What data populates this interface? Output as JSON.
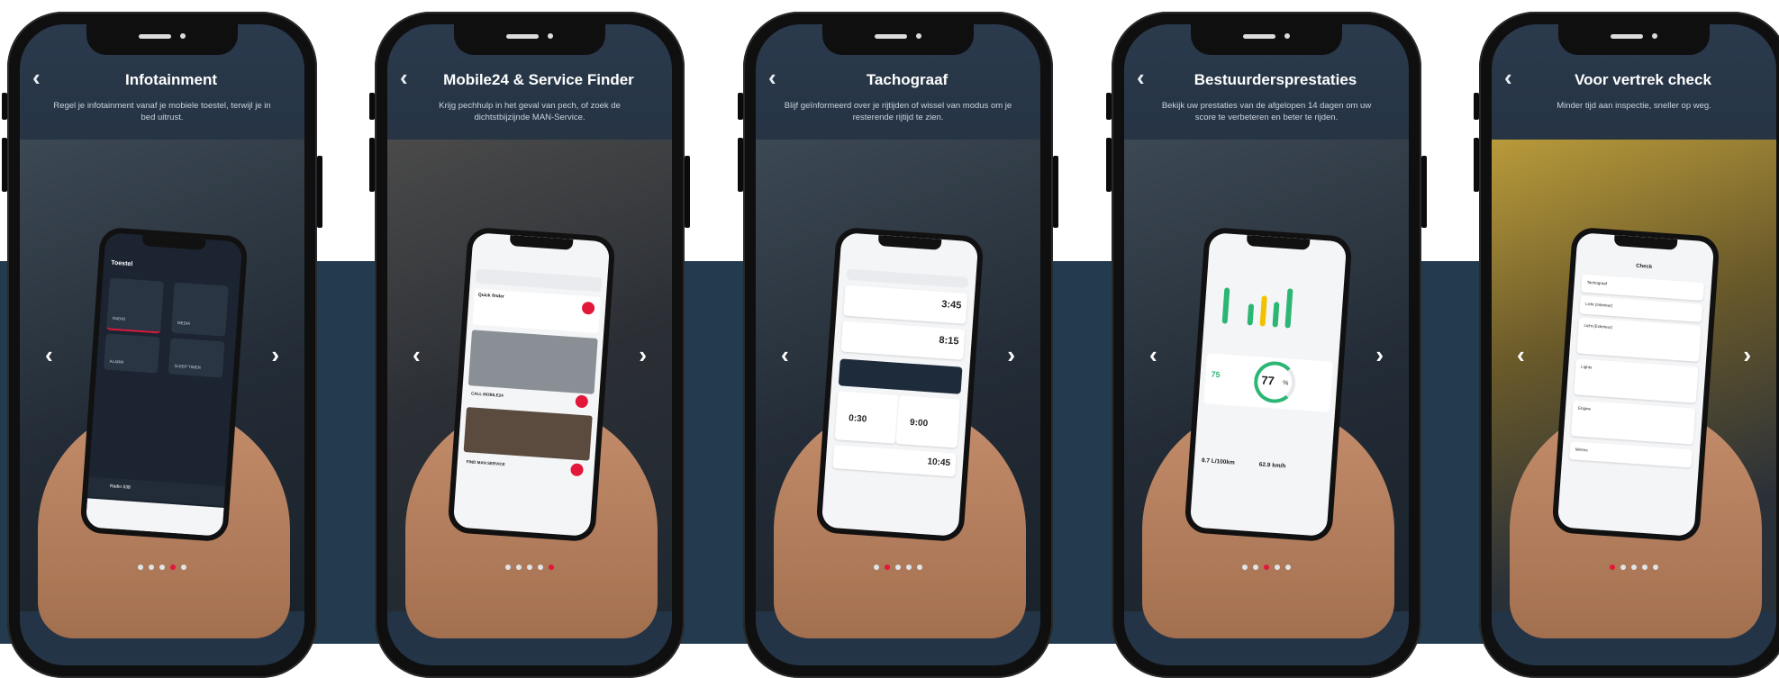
{
  "colors": {
    "band": "#243b4f",
    "accent": "#e2173a",
    "title": "#ffffff",
    "subtitle": "#c9d3dd"
  },
  "icons": {
    "back": "chevron-left-icon",
    "prev": "chevron-left-icon",
    "next": "chevron-right-icon"
  },
  "screens": [
    {
      "title": "Infotainment",
      "subtitle": "Regel je infotainment vanaf je mobiele toestel, terwijl je in bed uitrust.",
      "active_dot": 3,
      "mini": {
        "header": "Toestel",
        "tiles": [
          "RADIO",
          "MEDIA",
          "ALARM",
          "SLEEP TIMER"
        ],
        "now_playing": "Radio 538"
      }
    },
    {
      "title": "Mobile24 & Service Finder",
      "subtitle": "Krijg pechhulp in het geval van pech, of zoek de dichtstbijzijnde MAN-Service.",
      "active_dot": 4,
      "mini": {
        "cards": [
          "Quick finder",
          "CALL MOBILE24",
          "FIND MAN SERVICE"
        ]
      }
    },
    {
      "title": "Tachograaf",
      "subtitle": "Blijf geïnformeerd over je rijtijden of wissel van modus om je resterende rijtijd te zien.",
      "active_dot": 1,
      "mini": {
        "values": [
          "3:45",
          "8:15",
          "0:30",
          "9:00",
          "10:45"
        ]
      }
    },
    {
      "title": "Bestuurdersprestaties",
      "subtitle": "Bekijk uw prestaties van de afgelopen 14 dagen om uw score te verbeteren en beter te rijden.",
      "active_dot": 2,
      "mini": {
        "score": "77",
        "unit": "%",
        "left_score": "75",
        "stats": [
          "8.7 L/100km",
          "62.9 km/h"
        ]
      }
    },
    {
      "title": "Voor vertrek check",
      "subtitle": "Minder tijd aan inspectie, sneller op weg.",
      "active_dot": 0,
      "mini": {
        "header": "Check",
        "rows": [
          "Tachograaf",
          "Licht (Interieur)",
          "Licht (Exterieur)",
          "Lights",
          "Engine",
          "Mirrors"
        ]
      }
    }
  ]
}
